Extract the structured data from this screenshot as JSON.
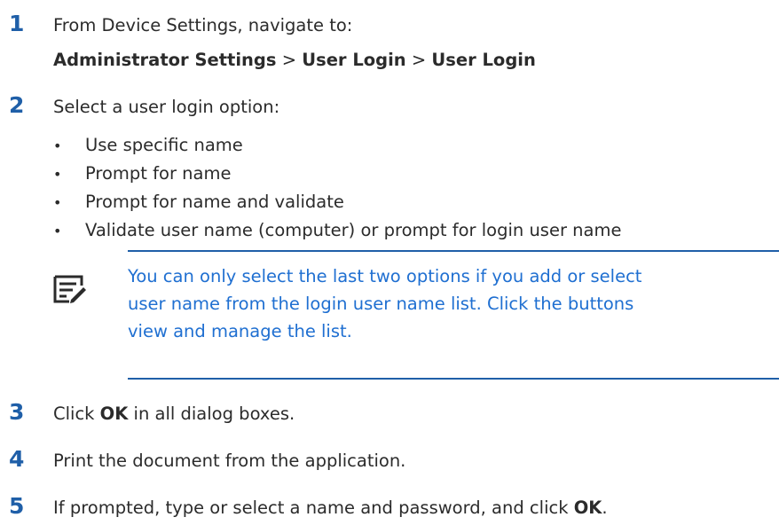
{
  "steps": [
    {
      "number": "1",
      "text": "From Device Settings, navigate to:"
    },
    {
      "number": "2",
      "text": "Select a user login option:"
    },
    {
      "number": "3",
      "text_before": "Click ",
      "text_bold": "OK",
      "text_after": " in all dialog boxes."
    },
    {
      "number": "4",
      "text": "Print the document from the application."
    },
    {
      "number": "5",
      "text_before": "If prompted, type or select a name and password, and click ",
      "text_bold": "OK",
      "text_after": "."
    }
  ],
  "nav_path": {
    "item1": "Administrator Settings",
    "sep1": " > ",
    "item2": "User Login",
    "sep2": " > ",
    "item3": "User Login"
  },
  "options": [
    "Use specific name",
    "Prompt for name",
    "Prompt for name and validate",
    "Validate user name (computer) or prompt for login user name"
  ],
  "note": {
    "icon": "note-icon",
    "lines": [
      "You can only select the last two options if you add or select",
      "user name from the login user name list. Click the buttons",
      "view and manage the list."
    ]
  },
  "colors": {
    "step_number": "#1f5fa8",
    "note_text": "#1f6fd1",
    "body_text": "#2b2b2b"
  }
}
